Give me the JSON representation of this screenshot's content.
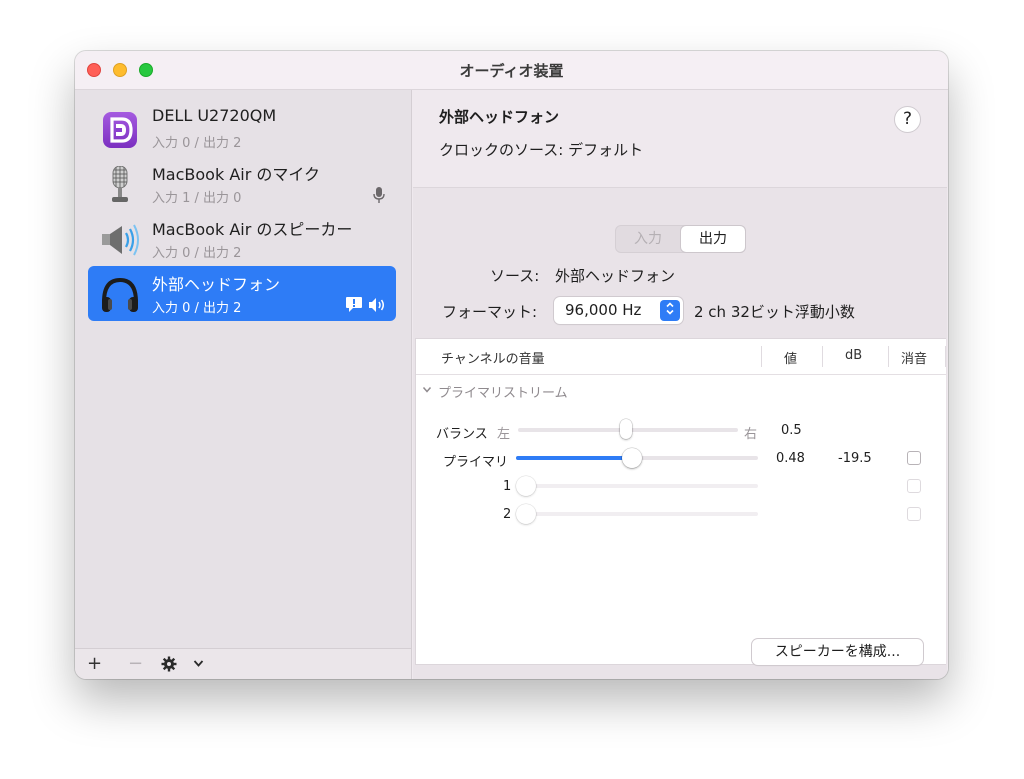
{
  "window": {
    "title": "オーディオ装置"
  },
  "devices": [
    {
      "name": "DELL U2720QM",
      "io": "入力 0 / 出力 2",
      "icon": "displayport-icon",
      "selected": false
    },
    {
      "name": "MacBook Air のマイク",
      "io": "入力 1 / 出力 0",
      "icon": "microphone-icon",
      "selected": false
    },
    {
      "name": "MacBook Air のスピーカー",
      "io": "入力 0 / 出力 2",
      "icon": "speaker-icon",
      "selected": false
    },
    {
      "name": "外部ヘッドフォン",
      "io": "入力 0 / 出力 2",
      "icon": "headphones-icon",
      "selected": true
    }
  ],
  "sidebar_toolbar": {
    "add": "+",
    "remove": "−"
  },
  "detail": {
    "title": "外部ヘッドフォン",
    "clock_source": "クロックのソース:  デフォルト",
    "help": "?",
    "tabs": [
      "入力",
      "出力"
    ],
    "active_tab": "出力",
    "source_label": "ソース:",
    "source_value": "外部ヘッドフォン",
    "format_label": "フォーマット:",
    "format_value": "96,000 Hz",
    "format_desc": "2 ch 32ビット浮動小数"
  },
  "table": {
    "headers": [
      "チャンネルの音量",
      "値",
      "dB",
      "消音"
    ],
    "stream_label": "プライマリストリーム",
    "balance": {
      "label": "バランス",
      "left": "左",
      "right": "右",
      "value": "0.5",
      "level": 0.5
    },
    "primary": {
      "label": "プライマリ",
      "value": "0.48",
      "db": "-19.5",
      "level": 0.48
    },
    "channels": [
      {
        "label": "1",
        "level": 0
      },
      {
        "label": "2",
        "level": 0
      }
    ]
  },
  "configure_button": "スピーカーを構成...",
  "colors": {
    "accent": "#2e7cf6",
    "close": "#ff5f57",
    "minimize": "#febc2e",
    "maximize": "#28c840"
  }
}
